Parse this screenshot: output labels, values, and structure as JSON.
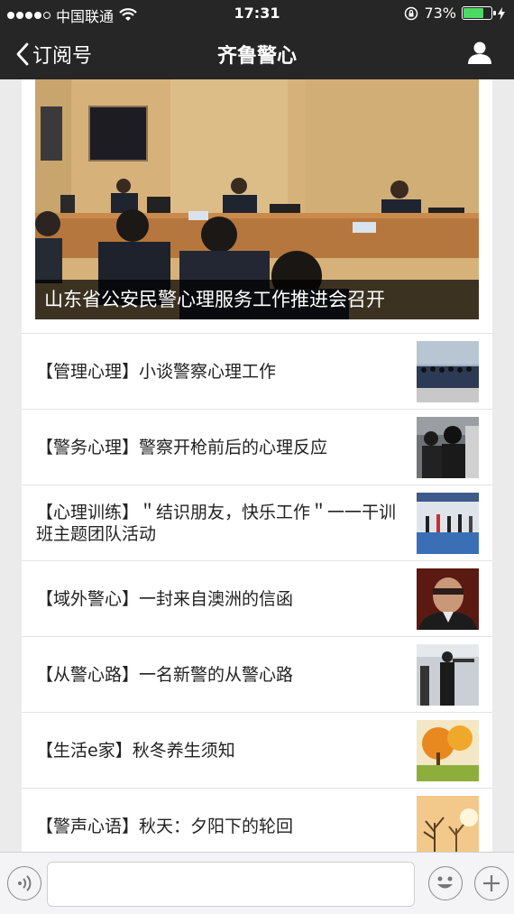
{
  "status": {
    "carrier": "中国联通",
    "time": "17:31",
    "battery": "73%",
    "battery_level": 0.73
  },
  "nav": {
    "back_label": "订阅号",
    "title": "齐鲁警心"
  },
  "hero": {
    "caption": "山东省公安民警心理服务工作推进会召开"
  },
  "articles": [
    {
      "title": "【管理心理】小谈警察心理工作"
    },
    {
      "title": "【警务心理】警察开枪前后的心理反应"
    },
    {
      "title": "【心理训练】＂结识朋友，快乐工作＂一一干训班主题团队活动"
    },
    {
      "title": "【域外警心】一封来自澳洲的信函"
    },
    {
      "title": "【从警心路】一名新警的从警心路"
    },
    {
      "title": "【生活e家】秋冬养生须知"
    },
    {
      "title": "【警声心语】秋天：夕阳下的轮回"
    }
  ],
  "input": {
    "placeholder": ""
  },
  "icons": {
    "back": "chevron-left-icon",
    "user": "person-icon",
    "voice": "voice-icon",
    "emoji": "smiley-icon",
    "plus": "plus-icon"
  },
  "colors": {
    "nav_bg": "#262626",
    "battery": "#4cd964",
    "page_bg": "#ebebeb"
  }
}
